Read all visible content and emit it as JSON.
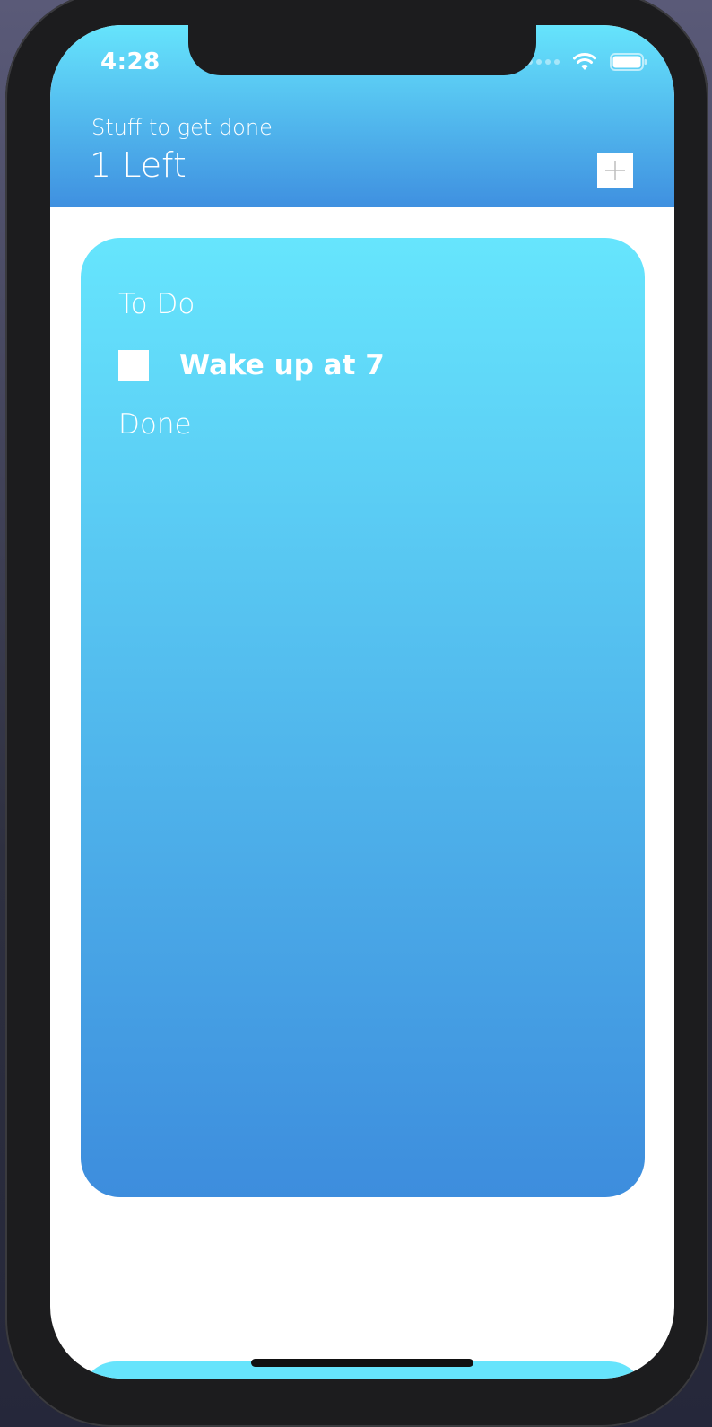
{
  "status_bar": {
    "time": "4:28"
  },
  "header": {
    "subtitle": "Stuff to get done",
    "count_label": "1 Left"
  },
  "list": {
    "todo_label": "To Do",
    "tasks": [
      {
        "text": "Wake up at 7",
        "done": false
      }
    ],
    "done_label": "Done"
  },
  "icons": {
    "add": "plus-icon",
    "wifi": "wifi-icon",
    "battery": "battery-icon",
    "signal": "cellular-signal-icon"
  },
  "colors": {
    "gradient_top": "#66e4fc",
    "gradient_bottom": "#3f90e0",
    "text": "#ffffff",
    "device_frame": "#1c1c1e"
  }
}
